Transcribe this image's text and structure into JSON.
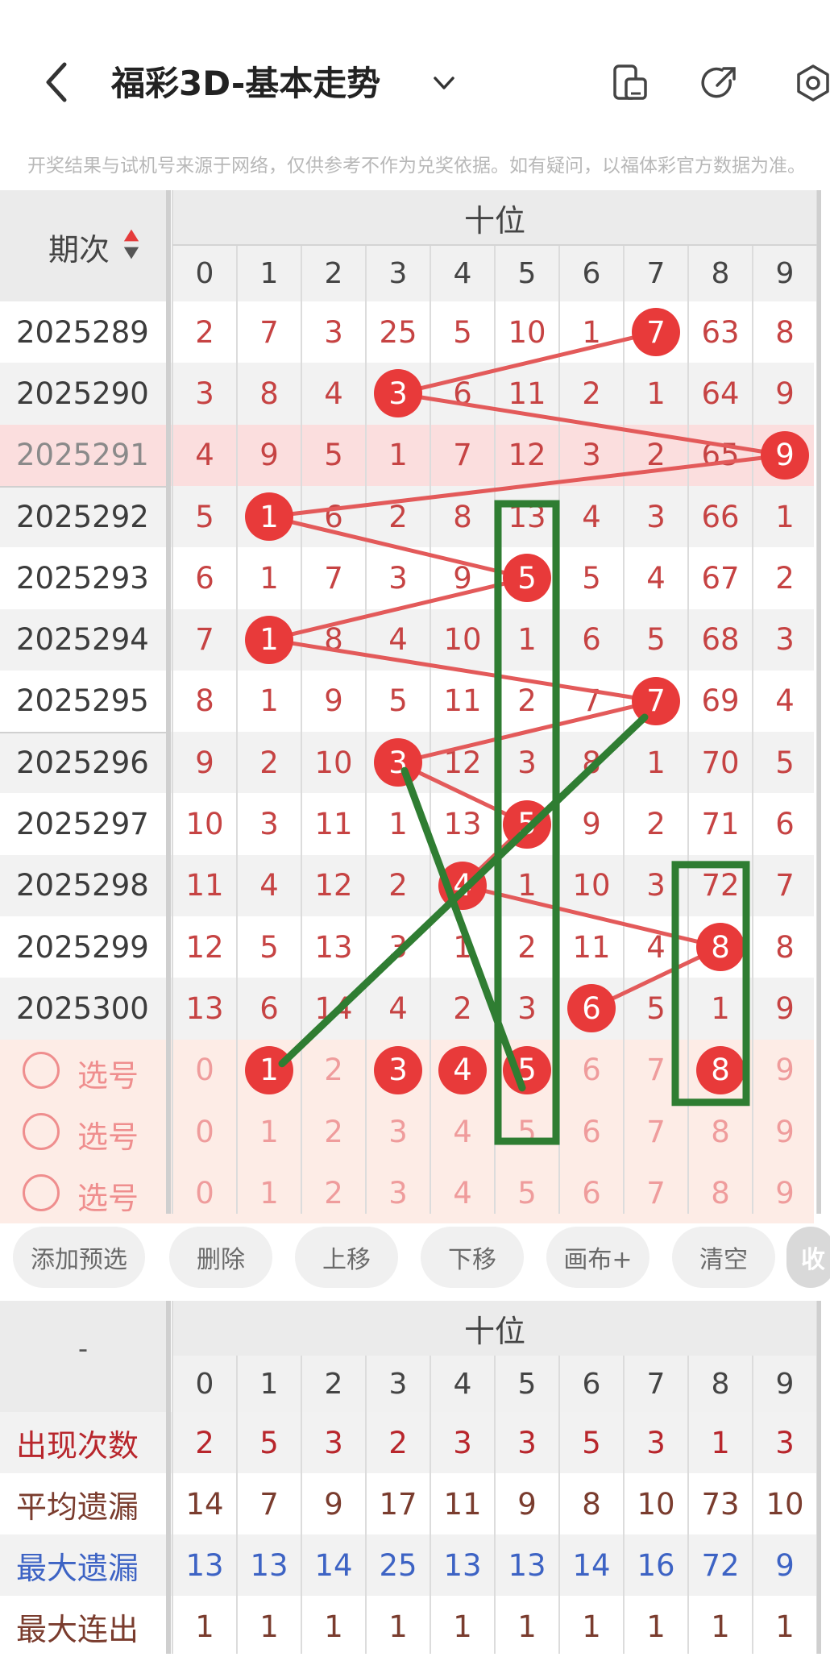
{
  "header": {
    "title": "福彩3D-基本走势",
    "notice": "开奖结果与试机号来源于网络，仅供参考不作为兑奖依据。如有疑问，以福体彩官方数据为准。"
  },
  "table": {
    "period_header": "期次",
    "section_header": "十位",
    "digits": [
      "0",
      "1",
      "2",
      "3",
      "4",
      "5",
      "6",
      "7",
      "8",
      "9"
    ],
    "rows": [
      {
        "period": "2025289",
        "cells": [
          "2",
          "7",
          "3",
          "25",
          "5",
          "10",
          "1",
          "7",
          "63",
          "8"
        ],
        "hit": 7
      },
      {
        "period": "2025290",
        "cells": [
          "3",
          "8",
          "4",
          "3",
          "6",
          "11",
          "2",
          "1",
          "64",
          "9"
        ],
        "hit": 3
      },
      {
        "period": "2025291",
        "cells": [
          "4",
          "9",
          "5",
          "1",
          "7",
          "12",
          "3",
          "2",
          "65",
          "9"
        ],
        "hit": 9
      },
      {
        "period": "2025292",
        "cells": [
          "5",
          "1",
          "6",
          "2",
          "8",
          "13",
          "4",
          "3",
          "66",
          "1"
        ],
        "hit": 1
      },
      {
        "period": "2025293",
        "cells": [
          "6",
          "1",
          "7",
          "3",
          "9",
          "5",
          "5",
          "4",
          "67",
          "2"
        ],
        "hit": 5
      },
      {
        "period": "2025294",
        "cells": [
          "7",
          "1",
          "8",
          "4",
          "10",
          "1",
          "6",
          "5",
          "68",
          "3"
        ],
        "hit": 1
      },
      {
        "period": "2025295",
        "cells": [
          "8",
          "1",
          "9",
          "5",
          "11",
          "2",
          "7",
          "7",
          "69",
          "4"
        ],
        "hit": 7
      },
      {
        "period": "2025296",
        "cells": [
          "9",
          "2",
          "10",
          "3",
          "12",
          "3",
          "8",
          "1",
          "70",
          "5"
        ],
        "hit": 3
      },
      {
        "period": "2025297",
        "cells": [
          "10",
          "3",
          "11",
          "1",
          "13",
          "5",
          "9",
          "2",
          "71",
          "6"
        ],
        "hit": 5
      },
      {
        "period": "2025298",
        "cells": [
          "11",
          "4",
          "12",
          "2",
          "4",
          "1",
          "10",
          "3",
          "72",
          "7"
        ],
        "hit": 4
      },
      {
        "period": "2025299",
        "cells": [
          "12",
          "5",
          "13",
          "3",
          "1",
          "2",
          "11",
          "4",
          "8",
          "8"
        ],
        "hit": 8
      },
      {
        "period": "2025300",
        "cells": [
          "13",
          "6",
          "14",
          "4",
          "2",
          "3",
          "6",
          "5",
          "1",
          "9"
        ],
        "hit": 6
      }
    ],
    "highlight_row": 2,
    "pick_label": "选号",
    "pick_rows": [
      {
        "cells": [
          "0",
          "1",
          "2",
          "3",
          "4",
          "5",
          "6",
          "7",
          "8",
          "9"
        ],
        "selected": [
          1,
          3,
          4,
          5,
          8
        ]
      },
      {
        "cells": [
          "0",
          "1",
          "2",
          "3",
          "4",
          "5",
          "6",
          "7",
          "8",
          "9"
        ],
        "selected": []
      },
      {
        "cells": [
          "0",
          "1",
          "2",
          "3",
          "4",
          "5",
          "6",
          "7",
          "8",
          "9"
        ],
        "selected": []
      }
    ]
  },
  "actions": [
    "添加预选",
    "删除",
    "上移",
    "下移",
    "画布+",
    "清空",
    "收"
  ],
  "stats": {
    "corner": "-",
    "section_header": "十位",
    "rows": [
      {
        "label": "出现次数",
        "values": [
          "2",
          "5",
          "3",
          "2",
          "3",
          "3",
          "5",
          "3",
          "1",
          "3"
        ],
        "color": "#b8262c"
      },
      {
        "label": "平均遗漏",
        "values": [
          "14",
          "7",
          "9",
          "17",
          "11",
          "9",
          "8",
          "10",
          "73",
          "10"
        ],
        "color": "#7a3c2e"
      },
      {
        "label": "最大遗漏",
        "values": [
          "13",
          "13",
          "14",
          "25",
          "13",
          "13",
          "14",
          "16",
          "72",
          "9"
        ],
        "color": "#3d63c4"
      },
      {
        "label": "最大连出",
        "values": [
          "1",
          "1",
          "1",
          "1",
          "1",
          "1",
          "1",
          "1",
          "1",
          "1"
        ],
        "color": "#7a3c2e"
      }
    ]
  },
  "colors": {
    "ball": "#e83a3a",
    "line_red": "#e35a5a",
    "line_green": "#2f7d32",
    "number": "#c64343"
  }
}
